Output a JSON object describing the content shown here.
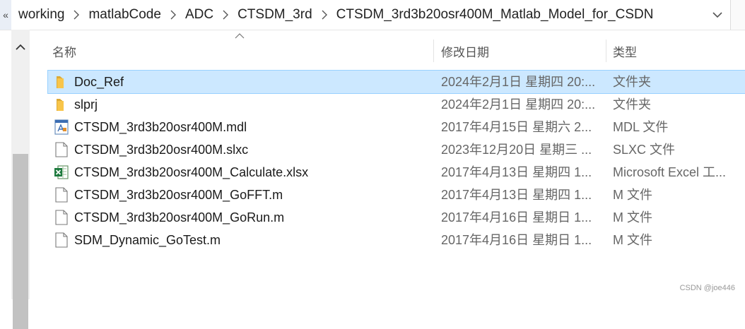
{
  "address_bar": {
    "left_chevron": "«",
    "breadcrumbs": [
      "working",
      "matlabCode",
      "ADC",
      "CTSDM_3rd",
      "CTSDM_3rd3b20osr400M_Matlab_Model_for_CSDN"
    ]
  },
  "columns": {
    "name": "名称",
    "date": "修改日期",
    "type": "类型"
  },
  "files": [
    {
      "name": "Doc_Ref",
      "date": "2024年2月1日 星期四 20:...",
      "type": "文件夹",
      "icon": "folder-icon",
      "selected": true
    },
    {
      "name": "slprj",
      "date": "2024年2月1日 星期四 20:...",
      "type": "文件夹",
      "icon": "folder-icon",
      "selected": false
    },
    {
      "name": "CTSDM_3rd3b20osr400M.mdl",
      "date": "2017年4月15日 星期六 2...",
      "type": "MDL 文件",
      "icon": "mdl-file-icon",
      "selected": false
    },
    {
      "name": "CTSDM_3rd3b20osr400M.slxc",
      "date": "2023年12月20日 星期三 ...",
      "type": "SLXC 文件",
      "icon": "file-icon",
      "selected": false
    },
    {
      "name": "CTSDM_3rd3b20osr400M_Calculate.xlsx",
      "date": "2017年4月13日 星期四 1...",
      "type": "Microsoft Excel 工...",
      "icon": "excel-file-icon",
      "selected": false
    },
    {
      "name": "CTSDM_3rd3b20osr400M_GoFFT.m",
      "date": "2017年4月13日 星期四 1...",
      "type": "M 文件",
      "icon": "file-icon",
      "selected": false
    },
    {
      "name": "CTSDM_3rd3b20osr400M_GoRun.m",
      "date": "2017年4月16日 星期日 1...",
      "type": "M 文件",
      "icon": "file-icon",
      "selected": false
    },
    {
      "name": "SDM_Dynamic_GoTest.m",
      "date": "2017年4月16日 星期日 1...",
      "type": "M 文件",
      "icon": "file-icon",
      "selected": false
    }
  ],
  "watermark": "CSDN @joe446",
  "colors": {
    "selection_bg": "#cce8ff",
    "folder": "#f8c54a",
    "excel": "#1d7a3e"
  }
}
